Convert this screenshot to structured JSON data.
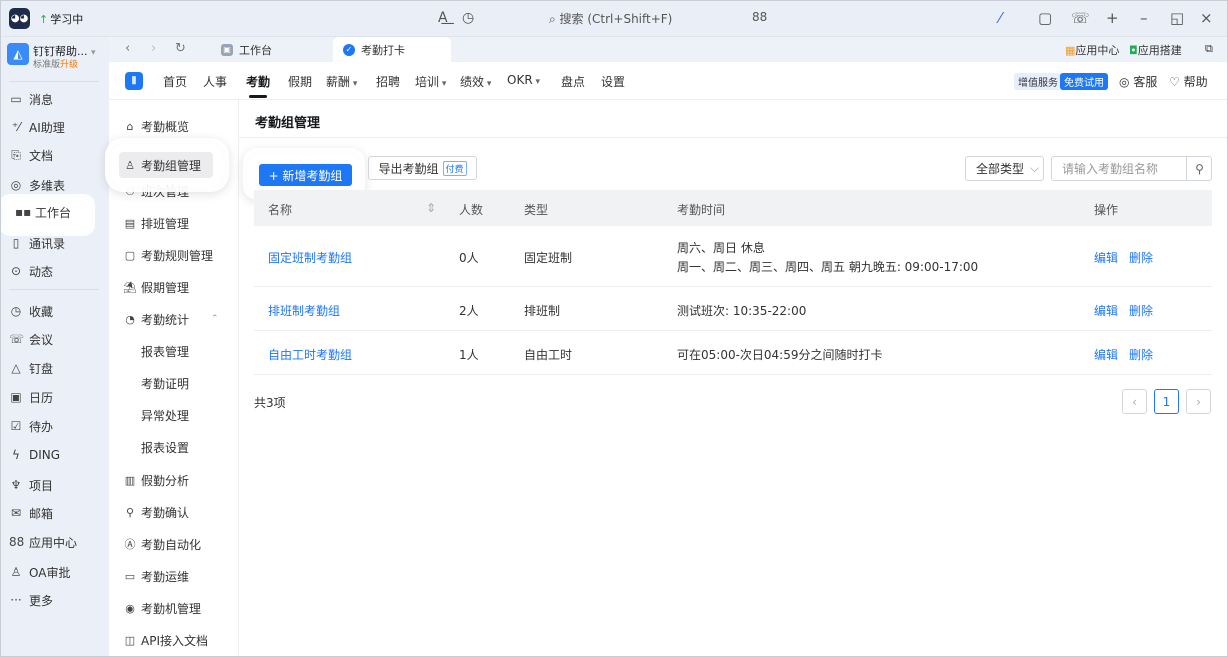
{
  "titlebar": {
    "study_label": "学习中",
    "search_placeholder": "搜索 (Ctrl+Shift+F)"
  },
  "org": {
    "name": "钉钉帮助...",
    "edition": "标准版",
    "upgrade": "升级"
  },
  "leftnav": {
    "items": [
      {
        "label": "消息",
        "icon": "message-icon"
      },
      {
        "label": "AI助理",
        "icon": "ai-icon"
      },
      {
        "label": "文档",
        "icon": "document-icon"
      },
      {
        "label": "多维表",
        "icon": "table-icon"
      },
      {
        "label": "工作台",
        "icon": "workbench-icon"
      },
      {
        "label": "通讯录",
        "icon": "contacts-icon"
      },
      {
        "label": "动态",
        "icon": "feed-icon"
      },
      {
        "label": "收藏",
        "icon": "favorite-icon"
      },
      {
        "label": "会议",
        "icon": "meeting-icon"
      },
      {
        "label": "钉盘",
        "icon": "drive-icon"
      },
      {
        "label": "日历",
        "icon": "calendar-icon"
      },
      {
        "label": "待办",
        "icon": "todo-icon"
      },
      {
        "label": "DING",
        "icon": "ding-icon"
      },
      {
        "label": "项目",
        "icon": "project-icon"
      },
      {
        "label": "邮箱",
        "icon": "mail-icon"
      },
      {
        "label": "应用中心",
        "icon": "app-center-icon"
      },
      {
        "label": "OA审批",
        "icon": "approval-icon"
      },
      {
        "label": "更多",
        "icon": "more-icon"
      }
    ]
  },
  "tabs": {
    "workbench": "工作台",
    "attendance": "考勤打卡",
    "app_center": "应用中心",
    "app_builder": "应用搭建"
  },
  "module_nav": {
    "items": [
      "首页",
      "人事",
      "考勤",
      "假期",
      "薪酬",
      "招聘",
      "培训",
      "绩效",
      "OKR",
      "盘点",
      "设置"
    ],
    "vas": "增值服务",
    "free": "免费试用",
    "service": "客服",
    "help": "帮助"
  },
  "sidemenu": {
    "items": [
      {
        "label": "考勤概览",
        "icon": "home-icon"
      },
      {
        "label": "考勤组管理",
        "icon": "user-group-icon"
      },
      {
        "label": "班次管理",
        "icon": "shift-icon"
      },
      {
        "label": "排班管理",
        "icon": "schedule-icon"
      },
      {
        "label": "考勤规则管理",
        "icon": "rules-icon"
      },
      {
        "label": "假期管理",
        "icon": "holiday-icon"
      },
      {
        "label": "考勤统计",
        "icon": "stats-icon"
      },
      {
        "label": "报表管理",
        "icon": ""
      },
      {
        "label": "考勤证明",
        "icon": ""
      },
      {
        "label": "异常处理",
        "icon": ""
      },
      {
        "label": "报表设置",
        "icon": ""
      },
      {
        "label": "假勤分析",
        "icon": "analysis-icon"
      },
      {
        "label": "考勤确认",
        "icon": "confirm-icon"
      },
      {
        "label": "考勤自动化",
        "icon": "automation-icon"
      },
      {
        "label": "考勤运维",
        "icon": "ops-icon"
      },
      {
        "label": "考勤机管理",
        "icon": "device-icon"
      },
      {
        "label": "API接入文档",
        "icon": "api-doc-icon"
      }
    ]
  },
  "main": {
    "title": "考勤组管理",
    "add_button": "+ 新增考勤组",
    "export_button": "导出考勤组",
    "paid_badge": "付费",
    "type_select": "全部类型",
    "search_placeholder": "请输入考勤组名称",
    "columns": [
      "名称",
      "人数",
      "类型",
      "考勤时间",
      "操作"
    ],
    "rows": [
      {
        "name": "固定班制考勤组",
        "count": "0人",
        "type": "固定班制",
        "time1": "周六、周日  休息",
        "time2": "周一、周二、周三、周四、周五  朝九晚五: 09:00-17:00",
        "edit": "编辑",
        "delete": "删除"
      },
      {
        "name": "排班制考勤组",
        "count": "2人",
        "type": "排班制",
        "time1": "测试班次: 10:35-22:00",
        "time2": "",
        "edit": "编辑",
        "delete": "删除"
      },
      {
        "name": "自由工时考勤组",
        "count": "1人",
        "type": "自由工时",
        "time1": "可在05:00-次日04:59分之间随时打卡",
        "time2": "",
        "edit": "编辑",
        "delete": "删除"
      }
    ],
    "total": "共3项",
    "page": "1"
  },
  "colors": {
    "accent": "#1e77f5",
    "leftnav_bg": "#ebeff7"
  }
}
